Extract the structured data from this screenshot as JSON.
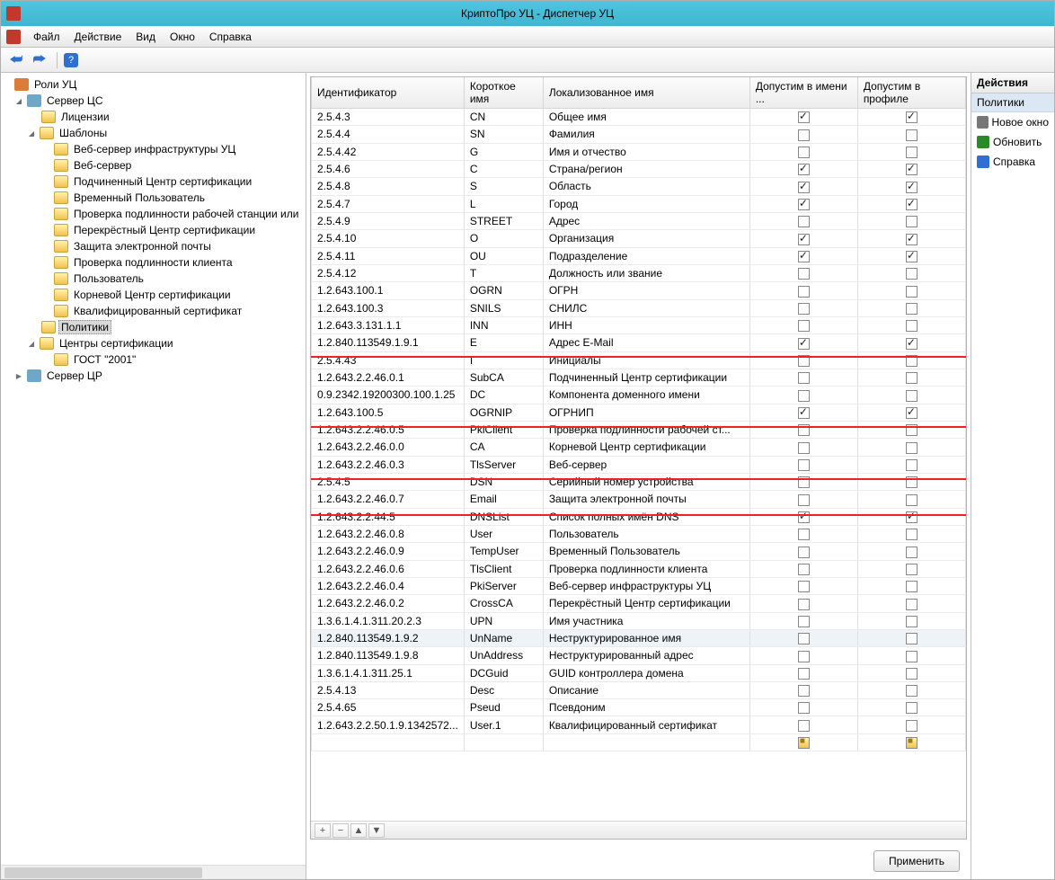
{
  "title": "КриптоПро УЦ - Диспетчер УЦ",
  "menu": {
    "file": "Файл",
    "action": "Действие",
    "view": "Вид",
    "window": "Окно",
    "help": "Справка"
  },
  "tree": {
    "root": "Роли УЦ",
    "serverCS": "Сервер ЦС",
    "licenses": "Лицензии",
    "templates": "Шаблоны",
    "tpl": [
      "Веб-сервер инфраструктуры УЦ",
      "Веб-сервер",
      "Подчиненный Центр сертификации",
      "Временный Пользователь",
      "Проверка подлинности рабочей станции или",
      "Перекрёстный Центр сертификации",
      "Защита электронной почты",
      "Проверка подлинности клиента",
      "Пользователь",
      "Корневой Центр сертификации",
      "Квалифицированный сертификат"
    ],
    "policies": "Политики",
    "certCenters": "Центры сертификации",
    "gost": "ГОСТ \"2001\"",
    "serverCR": "Сервер ЦР"
  },
  "grid": {
    "cols": {
      "id": "Идентификатор",
      "short": "Короткое имя",
      "loc": "Локализованное имя",
      "inName": "Допустим в имени ...",
      "inProfile": "Допустим в профиле"
    },
    "rows": [
      {
        "id": "2.5.4.3",
        "short": "CN",
        "loc": "Общее имя",
        "a": true,
        "b": true,
        "sel": false
      },
      {
        "id": "2.5.4.4",
        "short": "SN",
        "loc": "Фамилия",
        "a": false,
        "b": false
      },
      {
        "id": "2.5.4.42",
        "short": "G",
        "loc": "Имя и отчество",
        "a": false,
        "b": false
      },
      {
        "id": "2.5.4.6",
        "short": "C",
        "loc": "Страна/регион",
        "a": true,
        "b": true
      },
      {
        "id": "2.5.4.8",
        "short": "S",
        "loc": "Область",
        "a": true,
        "b": true
      },
      {
        "id": "2.5.4.7",
        "short": "L",
        "loc": "Город",
        "a": true,
        "b": true
      },
      {
        "id": "2.5.4.9",
        "short": "STREET",
        "loc": "Адрес",
        "a": false,
        "b": false
      },
      {
        "id": "2.5.4.10",
        "short": "O",
        "loc": "Организация",
        "a": true,
        "b": true
      },
      {
        "id": "2.5.4.11",
        "short": "OU",
        "loc": "Подразделение",
        "a": true,
        "b": true
      },
      {
        "id": "2.5.4.12",
        "short": "T",
        "loc": "Должность или звание",
        "a": false,
        "b": false
      },
      {
        "id": "1.2.643.100.1",
        "short": "OGRN",
        "loc": "ОГРН",
        "a": false,
        "b": false
      },
      {
        "id": "1.2.643.100.3",
        "short": "SNILS",
        "loc": "СНИЛС",
        "a": false,
        "b": false
      },
      {
        "id": "1.2.643.3.131.1.1",
        "short": "INN",
        "loc": "ИНН",
        "a": false,
        "b": false
      },
      {
        "id": "1.2.840.113549.1.9.1",
        "short": "E",
        "loc": "Адрес E-Mail",
        "a": true,
        "b": true
      },
      {
        "id": "2.5.4.43",
        "short": "I",
        "loc": "Инициалы",
        "a": false,
        "b": false
      },
      {
        "id": "1.2.643.2.2.46.0.1",
        "short": "SubCA",
        "loc": "Подчиненный Центр сертификации",
        "a": false,
        "b": false
      },
      {
        "id": "0.9.2342.19200300.100.1.25",
        "short": "DC",
        "loc": "Компонента доменного имени",
        "a": false,
        "b": false
      },
      {
        "id": "1.2.643.100.5",
        "short": "OGRNIP",
        "loc": "ОГРНИП",
        "a": true,
        "b": true
      },
      {
        "id": "1.2.643.2.2.46.0.5",
        "short": "PkiClient",
        "loc": "Проверка подлинности рабочей ст...",
        "a": false,
        "b": false
      },
      {
        "id": "1.2.643.2.2.46.0.0",
        "short": "CA",
        "loc": "Корневой Центр сертификации",
        "a": false,
        "b": false
      },
      {
        "id": "1.2.643.2.2.46.0.3",
        "short": "TlsServer",
        "loc": "Веб-сервер",
        "a": false,
        "b": false
      },
      {
        "id": "2.5.4.5",
        "short": "DSN",
        "loc": "Серийный номер устройства",
        "a": false,
        "b": false
      },
      {
        "id": "1.2.643.2.2.46.0.7",
        "short": "Email",
        "loc": "Защита электронной почты",
        "a": false,
        "b": false
      },
      {
        "id": "1.2.643.2.2.44.5",
        "short": "DNSList",
        "loc": "Список полных имён DNS",
        "a": true,
        "b": true
      },
      {
        "id": "1.2.643.2.2.46.0.8",
        "short": "User",
        "loc": "Пользователь",
        "a": false,
        "b": false
      },
      {
        "id": "1.2.643.2.2.46.0.9",
        "short": "TempUser",
        "loc": "Временный Пользователь",
        "a": false,
        "b": false
      },
      {
        "id": "1.2.643.2.2.46.0.6",
        "short": "TlsClient",
        "loc": "Проверка подлинности клиента",
        "a": false,
        "b": false
      },
      {
        "id": "1.2.643.2.2.46.0.4",
        "short": "PkiServer",
        "loc": "Веб-сервер инфраструктуры УЦ",
        "a": false,
        "b": false
      },
      {
        "id": "1.2.643.2.2.46.0.2",
        "short": "CrossCA",
        "loc": "Перекрёстный Центр сертификации",
        "a": false,
        "b": false
      },
      {
        "id": "1.3.6.1.4.1.311.20.2.3",
        "short": "UPN",
        "loc": "Имя участника",
        "a": false,
        "b": false
      },
      {
        "id": "1.2.840.113549.1.9.2",
        "short": "UnName",
        "loc": "Неструктурированное имя",
        "a": false,
        "b": false,
        "sel": true
      },
      {
        "id": "1.2.840.113549.1.9.8",
        "short": "UnAddress",
        "loc": "Неструктурированный адрес",
        "a": false,
        "b": false
      },
      {
        "id": "1.3.6.1.4.1.311.25.1",
        "short": "DCGuid",
        "loc": "GUID контроллера домена",
        "a": false,
        "b": false
      },
      {
        "id": "2.5.4.13",
        "short": "Desc",
        "loc": "Описание",
        "a": false,
        "b": false
      },
      {
        "id": "2.5.4.65",
        "short": "Pseud",
        "loc": "Псевдоним",
        "a": false,
        "b": false
      },
      {
        "id": "1.2.643.2.2.50.1.9.1342572...",
        "short": "User.1",
        "loc": "Квалифицированный сертификат",
        "a": false,
        "b": false
      }
    ],
    "footer": {
      "plus": "+",
      "minus": "−",
      "up": "▲",
      "down": "▼"
    }
  },
  "apply": "Применить",
  "actions": {
    "header": "Действия",
    "sub": "Политики",
    "newWindow": "Новое окно",
    "refresh": "Обновить",
    "help": "Справка"
  }
}
